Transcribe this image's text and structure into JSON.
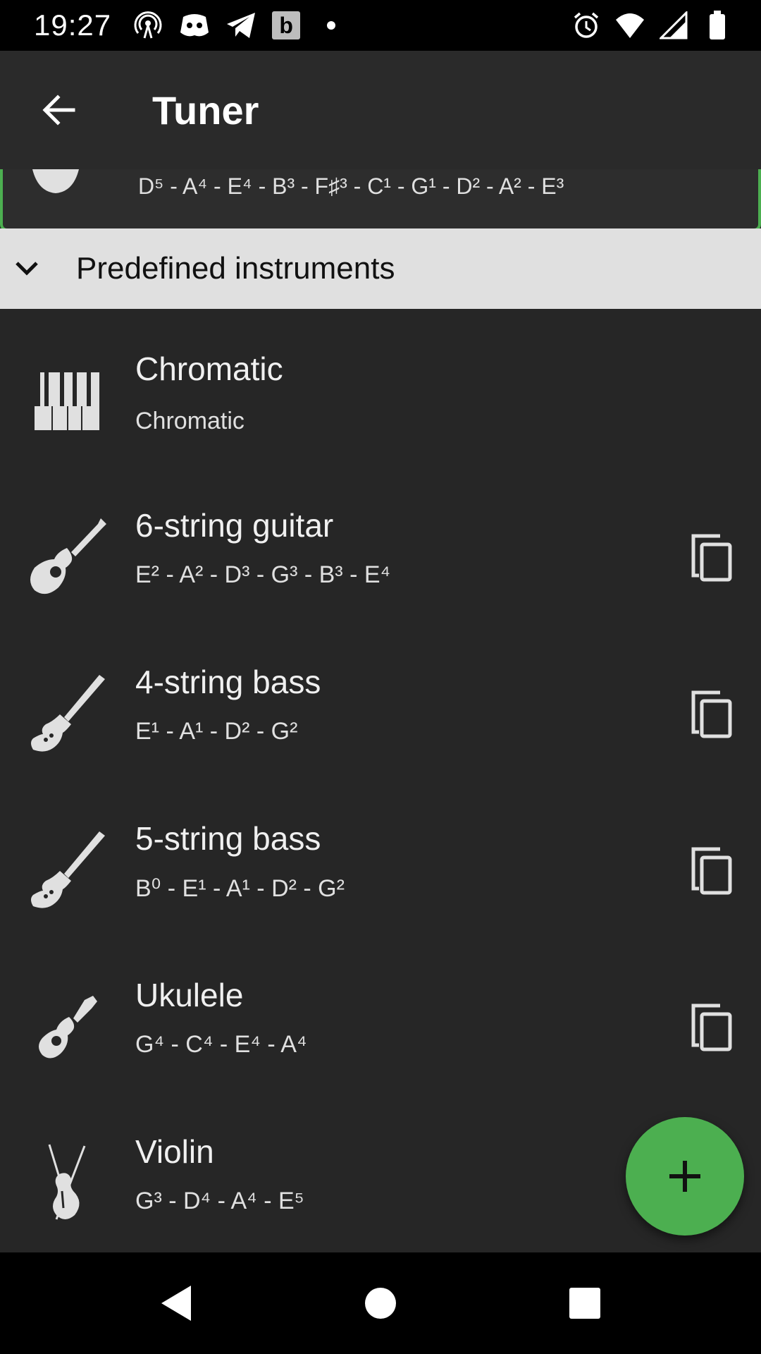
{
  "status_bar": {
    "time": "19:27",
    "left_icons": [
      "hotspot-icon",
      "discord-icon",
      "telegram-icon",
      "b-app-icon",
      "dot-icon"
    ],
    "b_label": "b",
    "right_icons": [
      "alarm-icon",
      "wifi-icon",
      "signal-icon",
      "battery-icon"
    ]
  },
  "app_bar": {
    "title": "Tuner",
    "back_icon": "arrow-back-icon"
  },
  "partial_card": {
    "notes": "D⁵ - A⁴ - E⁴ - B³ - F♯³ - C¹ - G¹ - D² - A² - E³",
    "accent_color": "#4caf50"
  },
  "section": {
    "title": "Predefined instruments",
    "icon": "chevron-down-icon",
    "background": "#e0e0e0"
  },
  "instruments": [
    {
      "name": "Chromatic",
      "notes": "Chromatic",
      "icon": "piano-icon",
      "copy": false
    },
    {
      "name": "6-string guitar",
      "notes": "E² - A² - D³ - G³ - B³ - E⁴",
      "icon": "guitar-icon",
      "copy": true
    },
    {
      "name": "4-string bass",
      "notes": "E¹ - A¹ - D² - G²",
      "icon": "bass-icon",
      "copy": true
    },
    {
      "name": "5-string bass",
      "notes": "B⁰ - E¹ - A¹ - D² - G²",
      "icon": "bass-icon",
      "copy": true
    },
    {
      "name": "Ukulele",
      "notes": "G⁴ - C⁴ - E⁴ - A⁴",
      "icon": "ukulele-icon",
      "copy": true
    },
    {
      "name": "Violin",
      "notes": "G³ - D⁴ - A⁴ - E⁵",
      "icon": "violin-icon",
      "copy": false
    }
  ],
  "fab": {
    "icon": "plus-icon",
    "color": "#4caf50"
  },
  "nav_bar": {
    "icons": [
      "back-triangle-icon",
      "home-circle-icon",
      "recents-square-icon"
    ]
  }
}
